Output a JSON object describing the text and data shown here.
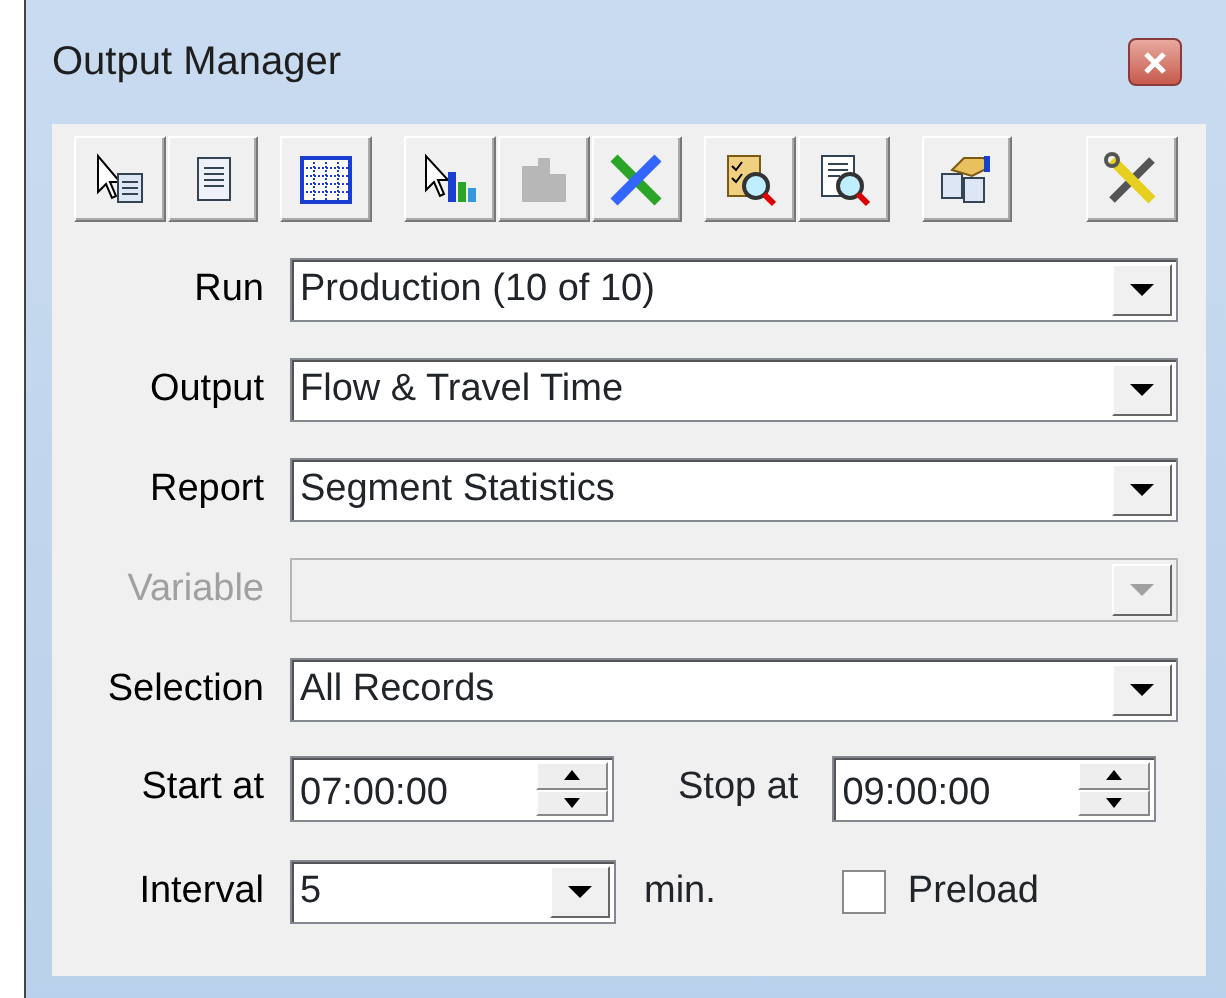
{
  "window": {
    "title": "Output Manager"
  },
  "toolbar": [
    [
      {
        "kind": "pointer-doc",
        "disabled": false
      },
      {
        "kind": "doc",
        "disabled": false
      }
    ],
    [
      {
        "kind": "grid",
        "disabled": false
      }
    ],
    [
      {
        "kind": "pointer-chart",
        "disabled": false
      },
      {
        "kind": "chart",
        "disabled": true
      },
      {
        "kind": "cross",
        "disabled": false
      }
    ],
    [
      {
        "kind": "check-search",
        "disabled": false
      },
      {
        "kind": "doc-search",
        "disabled": false
      }
    ],
    [
      {
        "kind": "copies",
        "disabled": false
      }
    ],
    [
      {
        "kind": "tools",
        "disabled": false
      }
    ]
  ],
  "fields": [
    {
      "label": "Run",
      "value": "Production (10 of 10)",
      "disabled": false
    },
    {
      "label": "Output",
      "value": "Flow & Travel Time",
      "disabled": false
    },
    {
      "label": "Report",
      "value": "Segment Statistics",
      "disabled": false
    },
    {
      "label": "Variable",
      "disabled": true
    },
    {
      "label": "Selection",
      "value": "All Records",
      "disabled": false
    }
  ],
  "start": {
    "label": "Start at",
    "value": "07:00:00"
  },
  "stop": {
    "label": "Stop at",
    "value": "09:00:00"
  },
  "interval": {
    "label": "Interval",
    "value": "5",
    "unit": "min."
  },
  "preload": {
    "label": "Preload",
    "checked": false
  }
}
